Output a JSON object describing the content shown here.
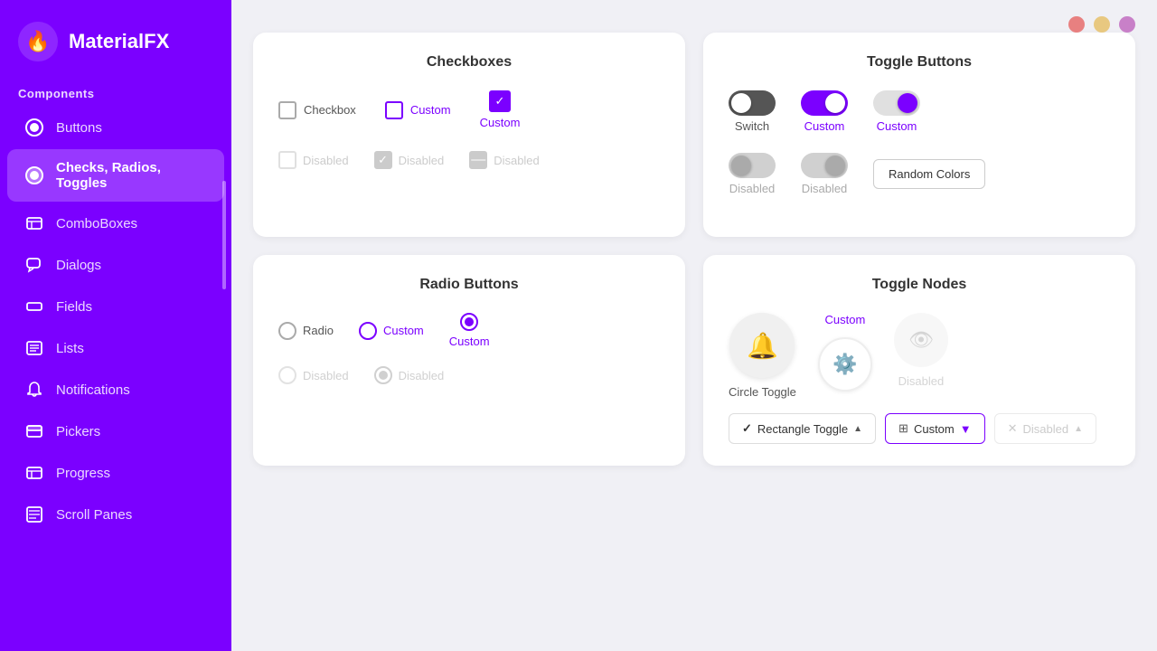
{
  "app": {
    "title": "MaterialFX",
    "logo_icon": "🔥"
  },
  "sidebar": {
    "section_label": "Components",
    "items": [
      {
        "id": "buttons",
        "label": "Buttons",
        "icon": "⬤"
      },
      {
        "id": "checks",
        "label": "Checks, Radios, Toggles",
        "icon": "⬤",
        "active": true
      },
      {
        "id": "comboboxes",
        "label": "ComboBoxes",
        "icon": "▤"
      },
      {
        "id": "dialogs",
        "label": "Dialogs",
        "icon": "💬"
      },
      {
        "id": "fields",
        "label": "Fields",
        "icon": "▭"
      },
      {
        "id": "lists",
        "label": "Lists",
        "icon": "≡"
      },
      {
        "id": "notifications",
        "label": "Notifications",
        "icon": "🔔"
      },
      {
        "id": "pickers",
        "label": "Pickers",
        "icon": "📁"
      },
      {
        "id": "progress",
        "label": "Progress",
        "icon": "▤"
      },
      {
        "id": "scroll-panes",
        "label": "Scroll Panes",
        "icon": "▤"
      }
    ]
  },
  "top_dots": [
    {
      "color": "#E88080"
    },
    {
      "color": "#E8C880"
    },
    {
      "color": "#C880C8"
    }
  ],
  "cards": {
    "checkboxes": {
      "title": "Checkboxes",
      "active_items": [
        {
          "label": "Checkbox"
        },
        {
          "label": "Custom"
        },
        {
          "label": "Custom",
          "large": true
        }
      ],
      "disabled_items": [
        {
          "label": "Disabled",
          "state": "empty"
        },
        {
          "label": "Disabled",
          "state": "checked"
        },
        {
          "label": "Disabled",
          "state": "indeterminate"
        }
      ]
    },
    "toggle_buttons": {
      "title": "Toggle Buttons",
      "active_items": [
        {
          "label": "Switch",
          "state": "off"
        },
        {
          "label": "Custom",
          "state": "on-purple"
        },
        {
          "label": "Custom",
          "state": "on-white"
        }
      ],
      "disabled_items": [
        {
          "label": "Disabled",
          "state": "off"
        },
        {
          "label": "Disabled",
          "state": "on"
        }
      ],
      "random_colors_btn": "Random Colors"
    },
    "radio_buttons": {
      "title": "Radio Buttons",
      "active_items": [
        {
          "label": "Radio",
          "selected": false
        },
        {
          "label": "Custom",
          "selected": false,
          "purple": true
        },
        {
          "label": "Custom",
          "selected": true,
          "purple": true
        }
      ],
      "disabled_items": [
        {
          "label": "Disabled",
          "selected": false
        },
        {
          "label": "Disabled",
          "selected": true
        }
      ]
    },
    "toggle_nodes": {
      "title": "Toggle Nodes",
      "circle_toggle": {
        "label": "Circle Toggle",
        "icon": "🔔"
      },
      "custom_toggle": {
        "label": "Custom",
        "icon": "⚙"
      },
      "disabled_toggle": {
        "label": "Disabled",
        "icon": "👁"
      },
      "rect_toggles": [
        {
          "label": "Rectangle Toggle",
          "has_check": true,
          "has_chevron": true,
          "disabled": false
        },
        {
          "label": "Custom",
          "has_grid": true,
          "has_filter": true,
          "disabled": false
        },
        {
          "label": "Disabled",
          "has_x": true,
          "has_chevron": true,
          "disabled": true
        }
      ]
    }
  }
}
